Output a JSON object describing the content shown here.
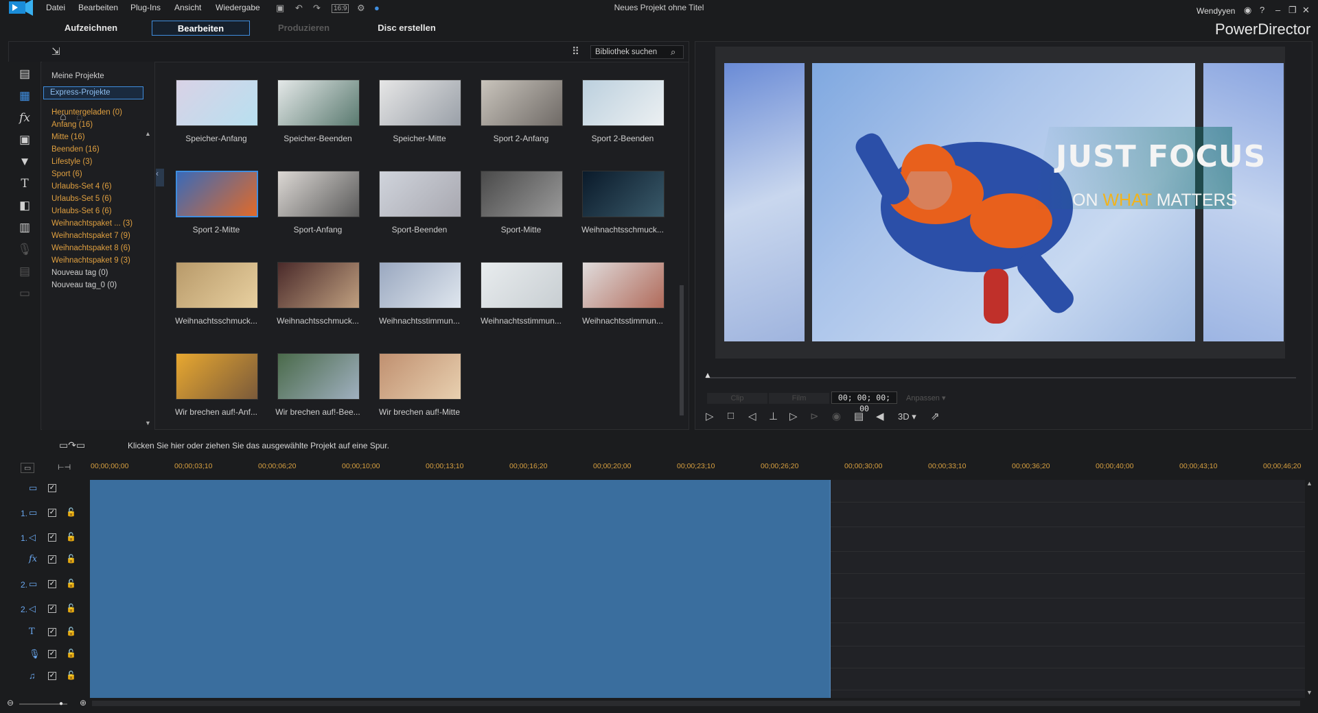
{
  "menu": [
    "Datei",
    "Bearbeiten",
    "Plug-Ins",
    "Ansicht",
    "Wiedergabe"
  ],
  "title": "Neues Projekt ohne Titel",
  "toolbar": {
    "ratio": "16:9"
  },
  "user": "Wendyyen",
  "modes": [
    "Aufzeichnen",
    "Bearbeiten",
    "Produzieren",
    "Disc erstellen"
  ],
  "brand": "PowerDirector",
  "library": {
    "search_placeholder": "Bibliothek suchen",
    "projects_label": "Meine Projekte",
    "express_label": "Express-Projekte",
    "categories": [
      {
        "label": "Heruntergeladen  (0)",
        "color": "orange"
      },
      {
        "label": "Anfang  (16)",
        "color": "orange"
      },
      {
        "label": "Mitte  (16)",
        "color": "orange"
      },
      {
        "label": "Beenden  (16)",
        "color": "orange"
      },
      {
        "label": "Lifestyle  (3)",
        "color": "orange"
      },
      {
        "label": "Sport  (6)",
        "color": "orange"
      },
      {
        "label": "Urlaubs-Set 4  (6)",
        "color": "orange"
      },
      {
        "label": "Urlaubs-Set 5  (6)",
        "color": "orange"
      },
      {
        "label": "Urlaubs-Set 6  (6)",
        "color": "orange"
      },
      {
        "label": "Weihnachtspaket ...  (3)",
        "color": "orange"
      },
      {
        "label": "Weihnachtspaket 7  (9)",
        "color": "orange"
      },
      {
        "label": "Weihnachtspaket 8  (6)",
        "color": "orange"
      },
      {
        "label": "Weihnachtspaket 9  (3)",
        "color": "orange"
      },
      {
        "label": "Nouveau tag  (0)",
        "color": "white"
      },
      {
        "label": "Nouveau tag_0  (0)",
        "color": "white"
      }
    ],
    "templates": [
      {
        "label": "Speicher-Anfang",
        "c1": "#d9d2e6",
        "c2": "#b8e0f0"
      },
      {
        "label": "Speicher-Beenden",
        "c1": "#e4e8e8",
        "c2": "#5a7a70"
      },
      {
        "label": "Speicher-Mitte",
        "c1": "#e6e6e6",
        "c2": "#9aa0a8"
      },
      {
        "label": "Sport 2-Anfang",
        "c1": "#c9c4bc",
        "c2": "#6f6a66"
      },
      {
        "label": "Sport 2-Beenden",
        "c1": "#bcd0de",
        "c2": "#ecf0f2"
      },
      {
        "label": "Sport 2-Mitte",
        "c1": "#3a6ab8",
        "c2": "#e06a2a",
        "selected": true
      },
      {
        "label": "Sport-Anfang",
        "c1": "#dcd8d4",
        "c2": "#5a5a5a"
      },
      {
        "label": "Sport-Beenden",
        "c1": "#d0d4dc",
        "c2": "#a8a8b0"
      },
      {
        "label": "Sport-Mitte",
        "c1": "#4a4a4a",
        "c2": "#9a9a9a"
      },
      {
        "label": "Weihnachtsschmuck...",
        "c1": "#0a1a2a",
        "c2": "#3a5a6a"
      },
      {
        "label": "Weihnachtsschmuck...",
        "c1": "#b89a6a",
        "c2": "#e8d0a0"
      },
      {
        "label": "Weihnachtsschmuck...",
        "c1": "#4a2a2a",
        "c2": "#c0a080"
      },
      {
        "label": "Weihnachtsstimmun...",
        "c1": "#9aa8c0",
        "c2": "#dfe6ee"
      },
      {
        "label": "Weihnachtsstimmun...",
        "c1": "#e8ecee",
        "c2": "#c8ced2"
      },
      {
        "label": "Weihnachtsstimmun...",
        "c1": "#e0dcdc",
        "c2": "#b06a5a"
      },
      {
        "label": "Wir brechen auf!-Anf...",
        "c1": "#e8a830",
        "c2": "#7a5a3a"
      },
      {
        "label": "Wir brechen auf!-Bee...",
        "c1": "#4a6a4a",
        "c2": "#a0b0c0"
      },
      {
        "label": "Wir brechen auf!-Mitte",
        "c1": "#c09070",
        "c2": "#e8d0b0"
      }
    ]
  },
  "preview": {
    "overlay_line1": "JUST FOCUS",
    "overlay_on": "ON ",
    "overlay_what": "WHAT",
    "overlay_rest": " MATTERS",
    "clip_label": "Clip",
    "film_label": "Film",
    "timecode": "00; 00; 00; 00",
    "fit_label": "Anpassen",
    "mode3d": "3D"
  },
  "hint": "Klicken Sie hier oder ziehen Sie das ausgewählte Projekt auf eine Spur.",
  "timeline": {
    "ticks": [
      "00;00;00;00",
      "00;00;03;10",
      "00;00;06;20",
      "00;00;10;00",
      "00;00;13;10",
      "00;00;16;20",
      "00;00;20;00",
      "00;00;23;10",
      "00;00;26;20",
      "00;00;30;00",
      "00;00;33;10",
      "00;00;36;20",
      "00;00;40;00",
      "00;00;43;10",
      "00;00;46;20"
    ],
    "tracks": [
      {
        "num": "",
        "icon": "▭",
        "type": "video-track"
      },
      {
        "num": "1.",
        "icon": "▭",
        "type": "video-track-1"
      },
      {
        "num": "1.",
        "icon": "◁",
        "type": "audio-track-1"
      },
      {
        "num": "",
        "icon": "fx",
        "type": "effect-track"
      },
      {
        "num": "2.",
        "icon": "▭",
        "type": "video-track-2"
      },
      {
        "num": "2.",
        "icon": "◁",
        "type": "audio-track-2"
      },
      {
        "num": "",
        "icon": "T",
        "type": "title-track"
      },
      {
        "num": "",
        "icon": "🎙",
        "type": "voice-track"
      },
      {
        "num": "",
        "icon": "♫",
        "type": "music-track"
      }
    ]
  },
  "colors": {
    "accent": "#3f8ee0",
    "category": "#e0a040",
    "clip": "#3a6e9e"
  }
}
